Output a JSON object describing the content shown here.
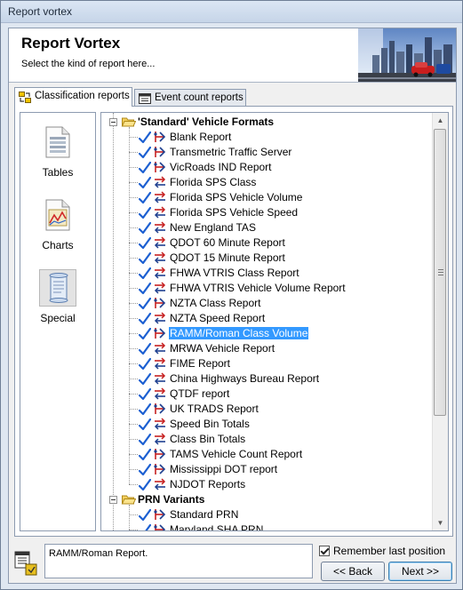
{
  "window": {
    "title": "Report vortex"
  },
  "header": {
    "title": "Report Vortex",
    "subtitle": "Select the kind of report here..."
  },
  "tabs": [
    {
      "label": "Classification reports",
      "active": true,
      "icon": "classification-icon"
    },
    {
      "label": "Event count reports",
      "active": false,
      "icon": "calendar-icon"
    }
  ],
  "sidebar": {
    "items": [
      {
        "label": "Tables",
        "icon": "table-document-icon",
        "selected": false
      },
      {
        "label": "Charts",
        "icon": "chart-document-icon",
        "selected": false
      },
      {
        "label": "Special",
        "icon": "scroll-icon",
        "selected": true
      }
    ]
  },
  "tree": {
    "groups": [
      {
        "label": "'Standard' Vehicle Formats",
        "expanded": true,
        "items": [
          {
            "label": "Blank Report",
            "icon": "classify-icon",
            "selected": false
          },
          {
            "label": "Transmetric Traffic Server",
            "icon": "classify-icon",
            "selected": false
          },
          {
            "label": "VicRoads IND Report",
            "icon": "classify-icon",
            "selected": false
          },
          {
            "label": "Florida SPS Class",
            "icon": "arrows-icon",
            "selected": false
          },
          {
            "label": "Florida SPS Vehicle Volume",
            "icon": "arrows-icon",
            "selected": false
          },
          {
            "label": "Florida SPS Vehicle Speed",
            "icon": "arrows-icon",
            "selected": false
          },
          {
            "label": "New England TAS",
            "icon": "arrows-icon",
            "selected": false
          },
          {
            "label": "QDOT 60 Minute Report",
            "icon": "arrows-icon",
            "selected": false
          },
          {
            "label": "QDOT 15 Minute Report",
            "icon": "arrows-icon",
            "selected": false
          },
          {
            "label": "FHWA VTRIS Class Report",
            "icon": "arrows-icon",
            "selected": false
          },
          {
            "label": "FHWA VTRIS Vehicle Volume Report",
            "icon": "arrows-icon",
            "selected": false
          },
          {
            "label": "NZTA Class Report",
            "icon": "classify-icon",
            "selected": false
          },
          {
            "label": "NZTA Speed Report",
            "icon": "arrows-icon",
            "selected": false
          },
          {
            "label": "RAMM/Roman Class Volume",
            "icon": "classify-icon",
            "selected": true
          },
          {
            "label": "MRWA Vehicle Report",
            "icon": "arrows-icon",
            "selected": false
          },
          {
            "label": "FIME Report",
            "icon": "arrows-icon",
            "selected": false
          },
          {
            "label": "China Highways Bureau Report",
            "icon": "arrows-icon",
            "selected": false
          },
          {
            "label": "QTDF report",
            "icon": "arrows-icon",
            "selected": false
          },
          {
            "label": "UK TRADS Report",
            "icon": "classify-icon",
            "selected": false
          },
          {
            "label": "Speed Bin Totals",
            "icon": "arrows-icon",
            "selected": false
          },
          {
            "label": "Class Bin Totals",
            "icon": "arrows-icon",
            "selected": false
          },
          {
            "label": "TAMS Vehicle Count Report",
            "icon": "classify-icon",
            "selected": false
          },
          {
            "label": "Mississippi DOT report",
            "icon": "classify-icon",
            "selected": false
          },
          {
            "label": "NJDOT Reports",
            "icon": "arrows-icon",
            "selected": false
          }
        ]
      },
      {
        "label": "PRN Variants",
        "expanded": true,
        "items": [
          {
            "label": "Standard PRN",
            "icon": "classify-icon",
            "selected": false
          },
          {
            "label": "Maryland SHA PRN",
            "icon": "classify-icon",
            "selected": false
          }
        ]
      }
    ]
  },
  "footer": {
    "status": "RAMM/Roman Report.",
    "remember_label": "Remember last position",
    "remember_checked": true,
    "back_label": "<< Back",
    "next_label": "Next >>"
  },
  "colors": {
    "selection": "#3399ff",
    "check": "#1c5fd1",
    "accent_red": "#cc2222"
  }
}
